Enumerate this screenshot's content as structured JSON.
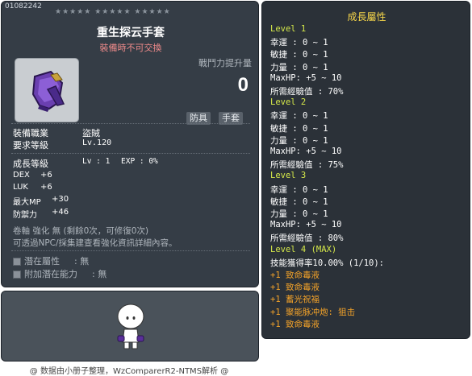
{
  "item": {
    "id": "01082242",
    "stars": "★★★★★  ★★★★★  ★★★★★",
    "name": "重生探云手套",
    "trade_note": "裝備時不可交換",
    "combat_label": "戰鬥力提升量",
    "combat_value": "0",
    "tags": [
      "防具",
      "手套"
    ]
  },
  "requirements": {
    "job_label": "裝備職業",
    "job_value": "盜賊",
    "level_label": "要求等級",
    "level_value": "Lv.120"
  },
  "growth_line": {
    "label": "成長等級",
    "lv": "Lv : 1",
    "exp": "EXP : 0%"
  },
  "stats": [
    {
      "name": "DEX",
      "value": "+6"
    },
    {
      "name": "LUK",
      "value": "+6"
    },
    {
      "name": "最大MP",
      "value": "+30"
    },
    {
      "name": "防禦力",
      "value": "+46"
    }
  ],
  "enhance": {
    "line1": "卷軸 強化 無 (剩餘0次，可修復0次)",
    "line2": "可透過NPC/採集建查看強化資訊詳細內容。"
  },
  "potential": {
    "potential_label": "潛在屬性",
    "potential_value": ": 無",
    "additional_label": "附加潛在能力",
    "additional_value": ": 無"
  },
  "footer": "@ 数据由小册子整理，WzComparerR2-NTMS解析 @",
  "growth_panel": {
    "title": "成長屬性",
    "lines": [
      {
        "text": "Level 1",
        "kind": "level"
      },
      {
        "text": "幸運 : 0 ~ 1",
        "kind": "stat"
      },
      {
        "text": "敏捷 : 0 ~ 1",
        "kind": "stat"
      },
      {
        "text": "力量 : 0 ~ 1",
        "kind": "stat"
      },
      {
        "text": "MaxHP:  +5 ~ 10",
        "kind": "stat"
      },
      {
        "text": "所需經驗值 : 70%",
        "kind": "stat"
      },
      {
        "text": "Level 2",
        "kind": "level"
      },
      {
        "text": "幸運 : 0 ~ 1",
        "kind": "stat"
      },
      {
        "text": "敏捷 : 0 ~ 1",
        "kind": "stat"
      },
      {
        "text": "力量 : 0 ~ 1",
        "kind": "stat"
      },
      {
        "text": "MaxHP:  +5 ~ 10",
        "kind": "stat"
      },
      {
        "text": "所需經驗值 : 75%",
        "kind": "stat"
      },
      {
        "text": "Level 3",
        "kind": "level"
      },
      {
        "text": "幸運 : 0 ~ 1",
        "kind": "stat"
      },
      {
        "text": "敏捷 : 0 ~ 1",
        "kind": "stat"
      },
      {
        "text": "力量 : 0 ~ 1",
        "kind": "stat"
      },
      {
        "text": "MaxHP:  +5 ~ 10",
        "kind": "stat"
      },
      {
        "text": "所需經驗值 : 80%",
        "kind": "stat"
      },
      {
        "text": "Level 4 (MAX)",
        "kind": "level"
      },
      {
        "text": "技能獲得率10.00% (1/10):",
        "kind": "stat"
      },
      {
        "text": "+1 致命毒液",
        "kind": "skill"
      },
      {
        "text": "+1 致命毒液",
        "kind": "skill"
      },
      {
        "text": "+1 蓄光祝福",
        "kind": "skill"
      },
      {
        "text": "+1 聚能脉冲炮: 狙击",
        "kind": "skill"
      },
      {
        "text": "+1 致命毒液",
        "kind": "skill"
      }
    ]
  }
}
